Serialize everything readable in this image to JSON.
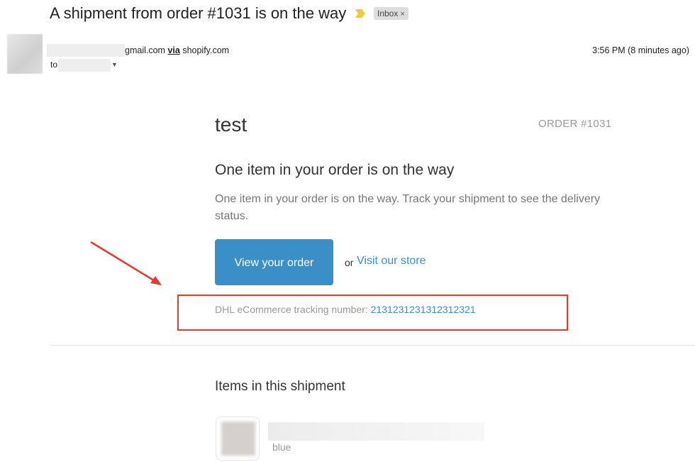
{
  "email": {
    "subject": "A shipment from order #1031 is on the way",
    "label": "Inbox",
    "label_remove": "×",
    "sender_domain": "gmail.com",
    "via_word": "via",
    "via_domain": "shopify.com",
    "to_label": "to",
    "timestamp": "3:56 PM (8 minutes ago)"
  },
  "message": {
    "shop_name": "test",
    "order_number": "ORDER #1031",
    "heading": "One item in your order is on the way",
    "body": "One item in your order is on the way. Track your shipment to see the delivery status.",
    "view_order_button": "View your order",
    "or_text": "or",
    "visit_store_link": "Visit our store",
    "tracking_label": "DHL eCommerce tracking number:",
    "tracking_number": "2131231231312312321",
    "items_heading": "Items in this shipment",
    "item_variant": "blue"
  },
  "colors": {
    "accent": "#3b8fc7",
    "annotation": "#e53a2b"
  }
}
